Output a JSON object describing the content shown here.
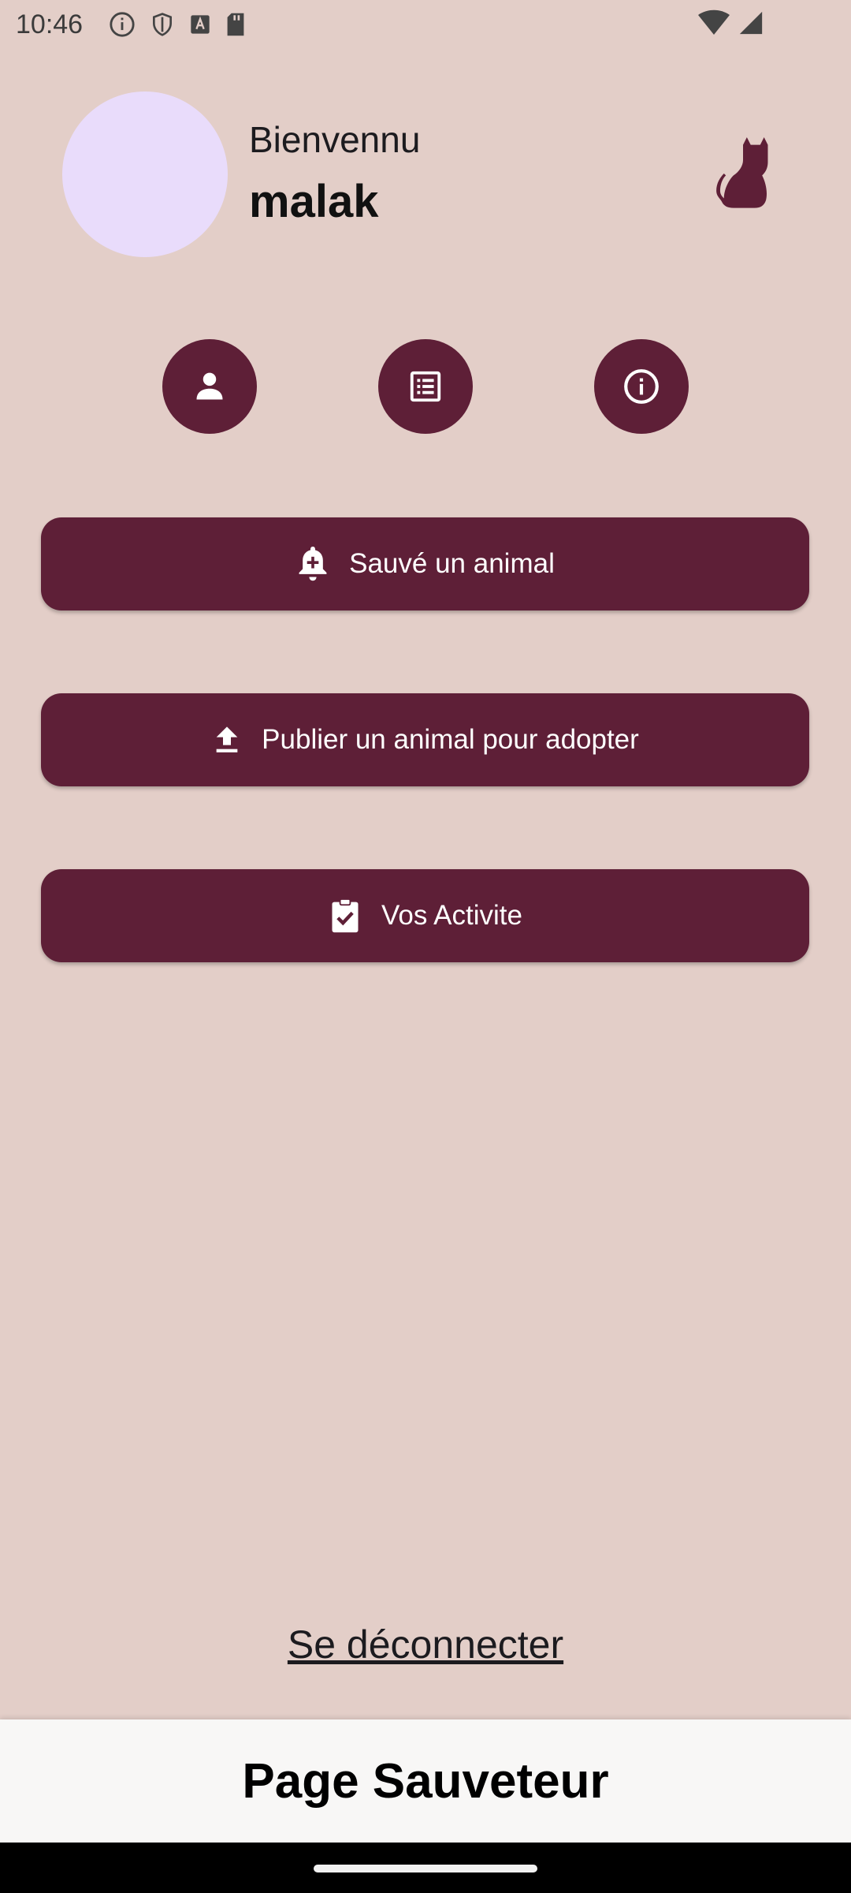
{
  "status_bar": {
    "time": "10:46"
  },
  "header": {
    "greeting": "Bienvennu",
    "username": "malak"
  },
  "icons": {
    "profile": "person-icon",
    "list": "list-icon",
    "info": "info-icon",
    "cat": "cat-icon"
  },
  "actions": [
    {
      "label": "Sauvé un animal",
      "icon": "bell-plus-icon"
    },
    {
      "label": "Publier un animal pour adopter",
      "icon": "upload-icon"
    },
    {
      "label": "Vos Activite",
      "icon": "clipboard-check-icon"
    }
  ],
  "logout": {
    "label": "Se déconnecter"
  },
  "footer": {
    "title": "Page Sauveteur"
  },
  "colors": {
    "background": "#e3cec8",
    "primary": "#5e1f37",
    "avatar": "#e9dcfb"
  }
}
